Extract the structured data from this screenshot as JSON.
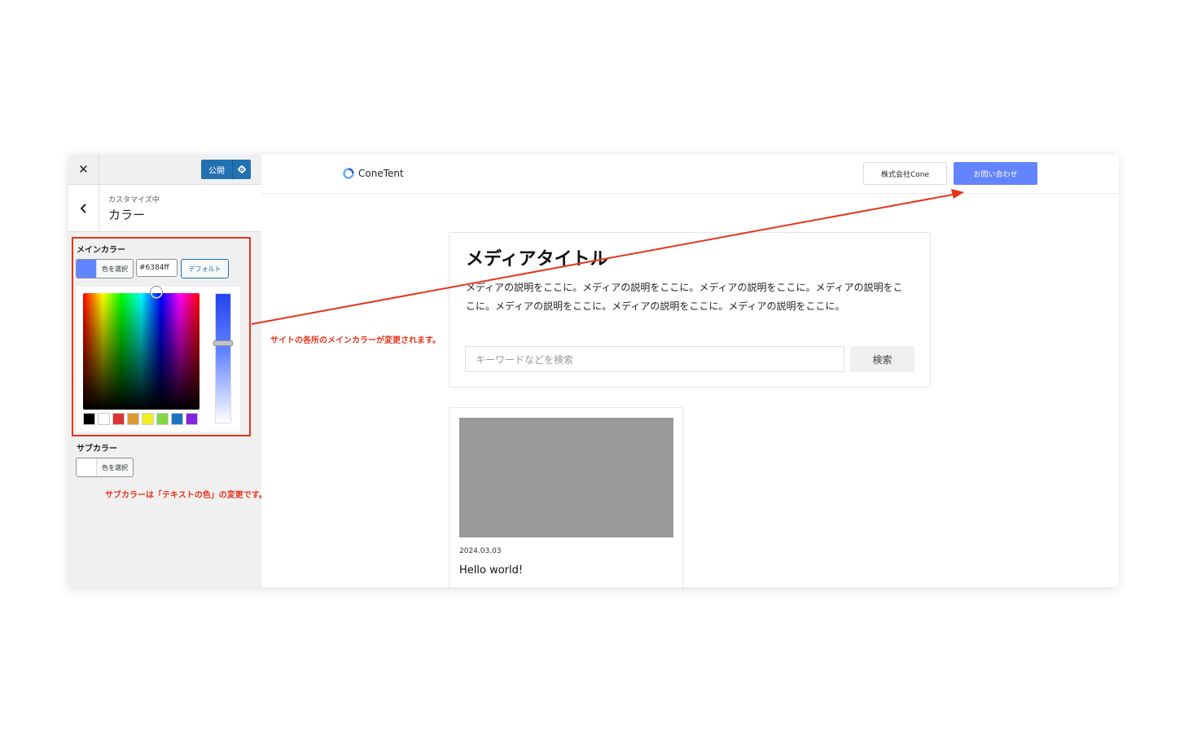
{
  "toolbar": {
    "close_icon": "close-icon",
    "publish_label": "公開"
  },
  "section": {
    "customizing_label": "カスタマイズ中",
    "title": "カラー"
  },
  "main_color": {
    "label": "メインカラー",
    "select_label": "色を選択",
    "hex_value": "#6384ff",
    "default_label": "デフォルト",
    "swatch_color": "#6384ff",
    "palette": [
      "#000000",
      "#ffffff",
      "#dd3333",
      "#dd9933",
      "#eeee22",
      "#81d742",
      "#1e73be",
      "#8224e3"
    ]
  },
  "sub_color": {
    "label": "サブカラー",
    "select_label": "色を選択",
    "swatch_color": "#ffffff"
  },
  "preview": {
    "logo_text": "ConeTent",
    "company_button": "株式会社Cone",
    "contact_button": "お問い合わせ",
    "hero_title": "メディアタイトル",
    "hero_description": "メディアの説明をここに。メディアの説明をここに。メディアの説明をここに。メディアの説明をここに。メディアの説明をここに。メディアの説明をここに。メディアの説明をここに。",
    "search_placeholder": "キーワードなどを検索",
    "search_button": "検索",
    "post_date": "2024.03.03",
    "post_title": "Hello world!"
  },
  "annotations": {
    "main_note": "サイトの各所のメインカラーが変更されます。",
    "sub_note": "サブカラーは「テキストの色」の変更です。",
    "accent_color": "#e8341c"
  }
}
